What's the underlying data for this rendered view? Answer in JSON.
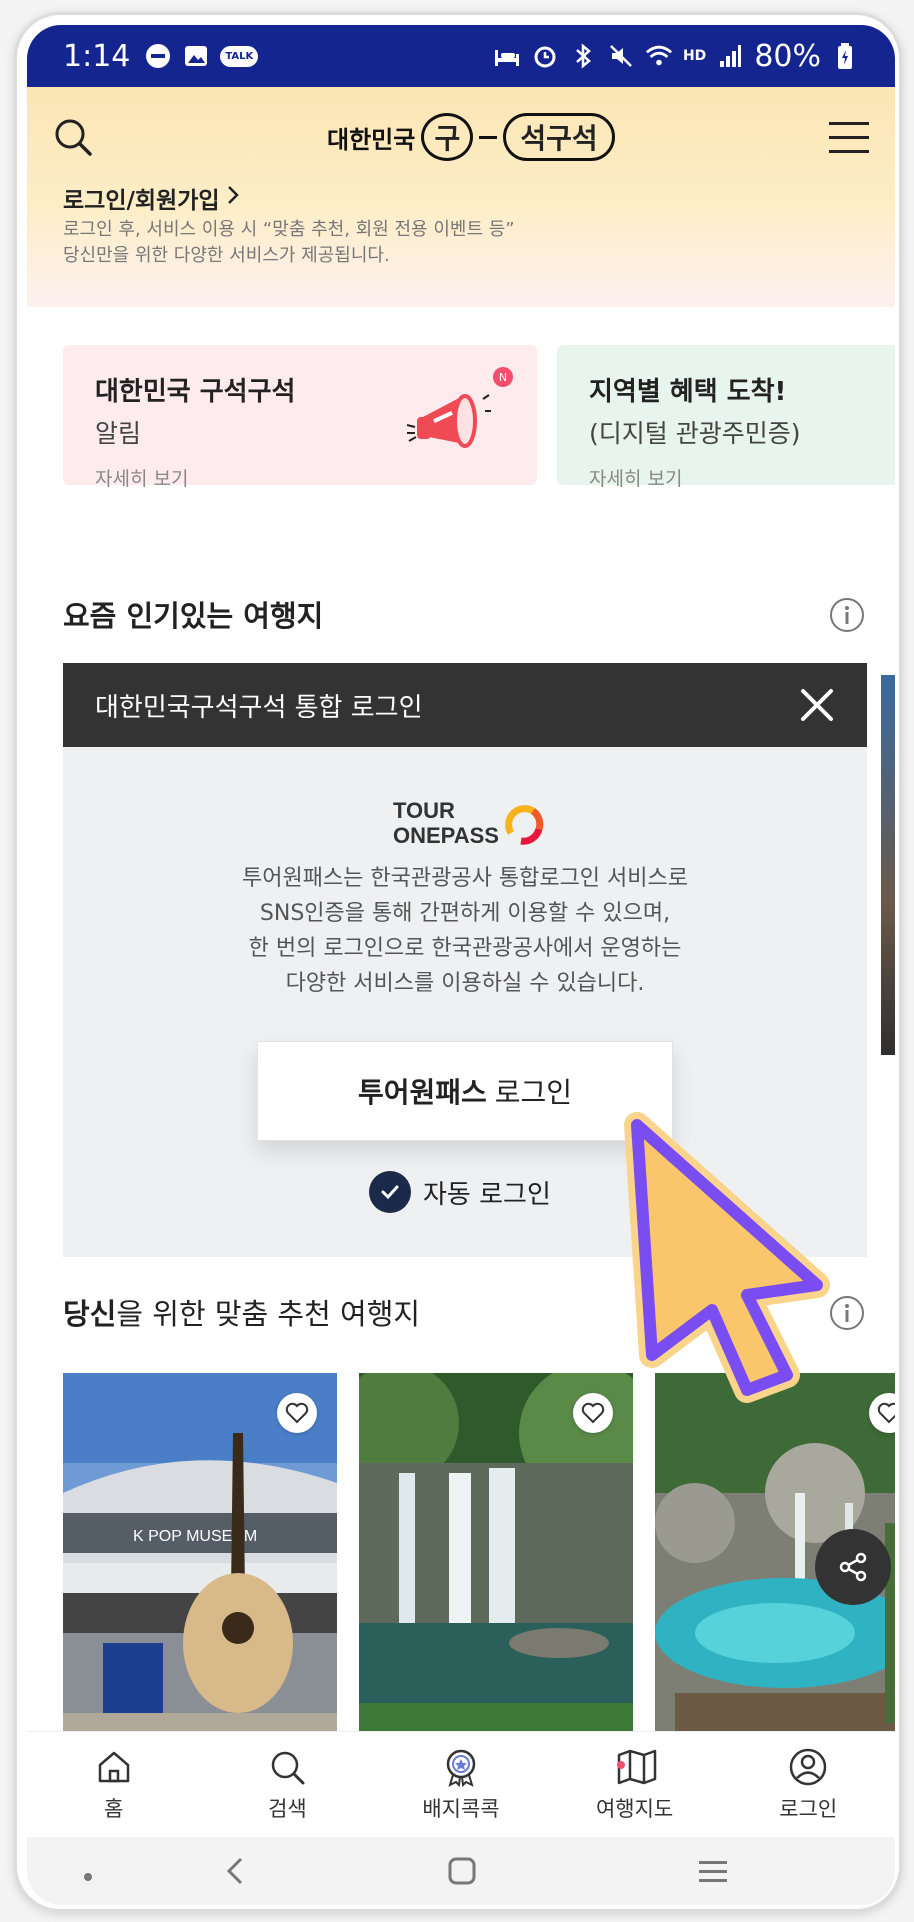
{
  "status_bar": {
    "time": "1:14",
    "battery": "80%",
    "talk_badge": "TALK",
    "hd_label": "HD",
    "colors": {
      "bar": "#14258f"
    }
  },
  "header": {
    "logo_prefix": "대한민국",
    "logo_circle": "구",
    "logo_pill": "석구석",
    "login_link": "로그인/회원가입",
    "login_desc_line1": "로그인 후, 서비스 이용 시 “맞춤 추천, 회원 전용 이벤트 등”",
    "login_desc_line2": "당신만을 위한 다양한 서비스가 제공됩니다."
  },
  "cards": [
    {
      "title": "대한민국 구석구석",
      "subtitle": "알림",
      "more": "자세히 보기",
      "badge": "N",
      "icon": "megaphone-icon"
    },
    {
      "title": "지역별 혜택 도착!",
      "subtitle": "(디지털 관광주민증)",
      "more": "자세히 보기"
    }
  ],
  "section_popular": {
    "title": "요즘 인기있는 여행지"
  },
  "login_modal": {
    "title": "대한민국구석구석 통합 로그인",
    "logo_line1": "TOUR",
    "logo_line2": "ONEPASS",
    "desc_line1": "투어원패스는 한국관광공사 통합로그인 서비스로",
    "desc_line2": "SNS인증을 통해 간편하게 이용할 수 있으며,",
    "desc_line3": "한 번의 로그인으로 한국관광공사에서 운영하는",
    "desc_line4": "다양한 서비스를 이용하실 수 있습니다.",
    "button_bold": "투어원패스",
    "button_rest": "로그인",
    "auto_login": "자동 로그인",
    "auto_login_checked": true
  },
  "section_recommend": {
    "title_bold": "당신",
    "title_rest": "을 위한 맞춤 추천 여행지"
  },
  "thumbnails": [
    {
      "name": "kpop-museum",
      "sign": "K POP MUSEUM"
    },
    {
      "name": "waterfall"
    },
    {
      "name": "blue-pool"
    }
  ],
  "bottom_nav": [
    {
      "label": "홈",
      "icon": "home-icon"
    },
    {
      "label": "검색",
      "icon": "search-icon"
    },
    {
      "label": "배지콕콕",
      "icon": "badge-icon"
    },
    {
      "label": "여행지도",
      "icon": "map-icon"
    },
    {
      "label": "로그인",
      "icon": "user-icon"
    }
  ],
  "colors": {
    "pointer_fill": "#f9c66b",
    "pointer_stroke": "#7a4df2",
    "accent_red": "#f0506e"
  }
}
